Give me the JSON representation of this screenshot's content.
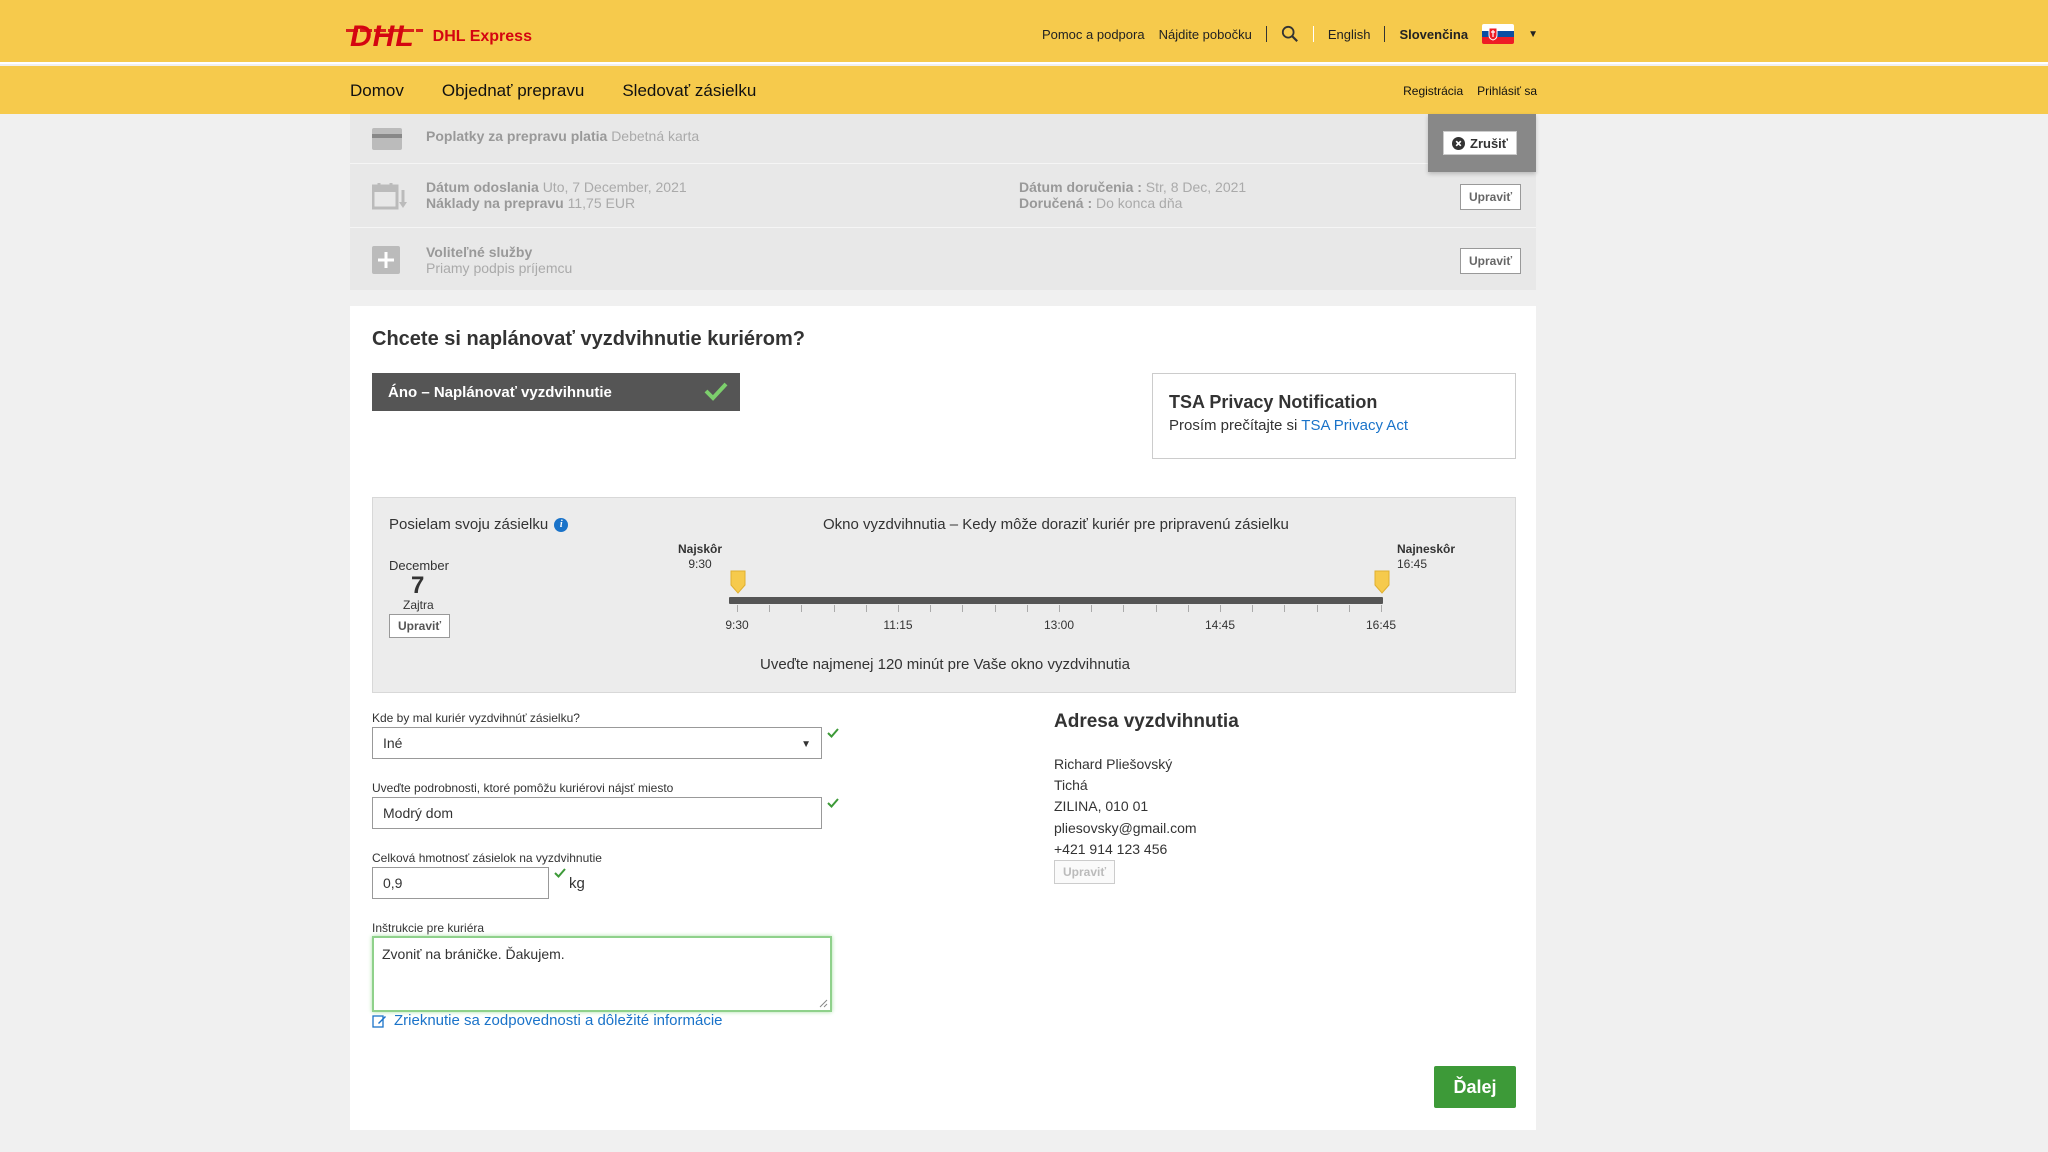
{
  "header": {
    "logo_text": "DHL",
    "brand": "DHL Express",
    "links": [
      "Pomoc a podpora",
      "Nájdite pobočku"
    ],
    "lang_english": "English",
    "lang_slovak": "Slovenčina",
    "icons": {
      "search": "search-icon",
      "flag": "slovak-flag-icon",
      "dropdown": "chevron-down-icon"
    }
  },
  "nav": {
    "items": [
      "Domov",
      "Objednať prepravu",
      "Sledovať zásielku"
    ],
    "register": "Registrácia",
    "login": "Prihlásiť sa"
  },
  "summary": {
    "payment_label": "Poplatky za prepravu platia",
    "payment_value": "Debetná karta",
    "ship_date_label": "Dátum odoslania",
    "ship_date_value": "Uto, 7 December, 2021",
    "cost_label": "Náklady na prepravu",
    "cost_value": "11,75 EUR",
    "delivery_date_label": "Dátum doručenia :",
    "delivery_date_value": "Str, 8 Dec, 2021",
    "delivered_label": "Doručená :",
    "delivered_value": "Do konca dňa",
    "optional_label": "Voliteľné služby",
    "optional_value": "Priamy podpis príjemcu",
    "cancel_label": "Zrušiť",
    "edit_label": "Upraviť"
  },
  "pickup": {
    "question": "Chcete si naplánovať vyzdvihnutie kuriérom?",
    "yes_label": "Áno – Naplánovať vyzdvihnutie",
    "tsa_title": "TSA Privacy Notification",
    "tsa_text": "Prosím prečítajte si",
    "tsa_link": "TSA Privacy Act"
  },
  "window": {
    "sending_label": "Posielam svoju zásielku",
    "title": "Okno vyzdvihnutia – Kedy môže doraziť kuriér pre pripravenú zásielku",
    "month": "December",
    "day": "7",
    "day_note": "Zajtra",
    "edit_label": "Upraviť",
    "earliest_label": "Najskôr",
    "earliest_time": "9:30",
    "latest_label": "Najneskôr",
    "latest_time": "16:45",
    "ticks": [
      "9:30",
      "11:15",
      "13:00",
      "14:45",
      "16:45"
    ],
    "hint": "Uveďte najmenej 120 minút pre Vaše okno vyzdvihnutia"
  },
  "form": {
    "location_label": "Kde by mal kuriér vyzdvihnúť zásielku?",
    "location_value": "Iné",
    "details_label": "Uveďte podrobnosti, ktoré pomôžu kuriérovi nájsť miesto",
    "details_value": "Modrý dom",
    "weight_label": "Celková hmotnosť zásielok na vyzdvihnutie",
    "weight_value": "0,9",
    "weight_unit": "kg",
    "instructions_label": "Inštrukcie pre kuriéra",
    "instructions_value": "Zvoniť na bráničke. Ďakujem.",
    "disclaimer": "Zrieknutie sa zodpovednosti a dôležité informácie"
  },
  "address": {
    "title": "Adresa vyzdvihnutia",
    "name": "Richard Pliešovský",
    "street": "Tichá",
    "city": "ZILINA, 010 01",
    "email": "pliesovsky@gmail.com",
    "phone": "+421 914 123 456",
    "edit_label": "Upraviť"
  },
  "next_label": "Ďalej",
  "colors": {
    "dhl_yellow": "#f6ca4c",
    "dhl_red": "#d40511",
    "green": "#3d9a38",
    "link_blue": "#1a73c9"
  }
}
